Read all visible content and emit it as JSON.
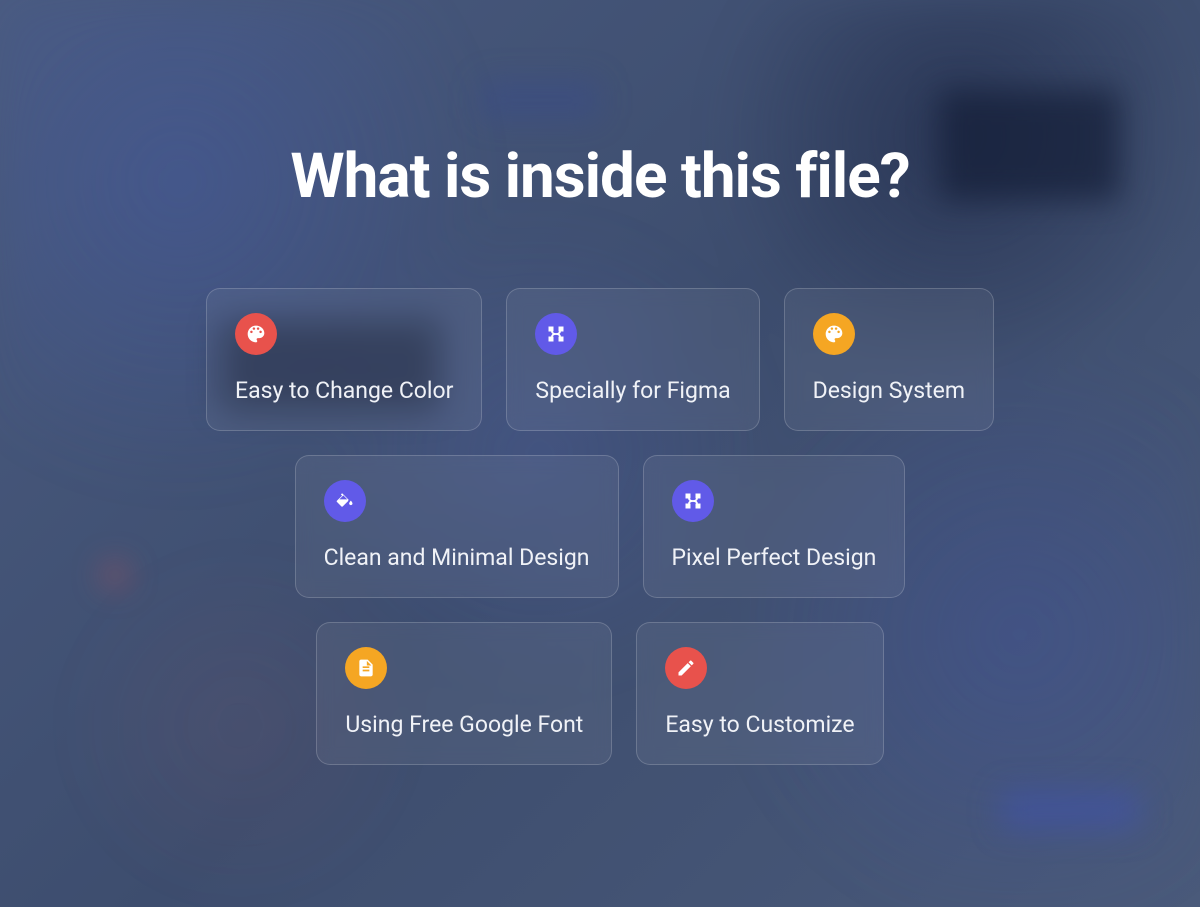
{
  "heading": "What is inside this file?",
  "cards": {
    "row1": [
      {
        "label": "Easy to Change Color",
        "icon": "palette",
        "color": "red"
      },
      {
        "label": "Specially for Figma",
        "icon": "vector",
        "color": "purple"
      },
      {
        "label": "Design System",
        "icon": "palette",
        "color": "orange"
      }
    ],
    "row2": [
      {
        "label": "Clean and Minimal Design",
        "icon": "paint-bucket",
        "color": "purple"
      },
      {
        "label": "Pixel Perfect Design",
        "icon": "vector",
        "color": "purple"
      }
    ],
    "row3": [
      {
        "label": "Using Free Google Font",
        "icon": "document",
        "color": "orange"
      },
      {
        "label": "Easy to Customize",
        "icon": "edit",
        "color": "red"
      }
    ]
  },
  "colors": {
    "red": "#e8524c",
    "purple": "#615ae8",
    "orange": "#f5a623"
  }
}
